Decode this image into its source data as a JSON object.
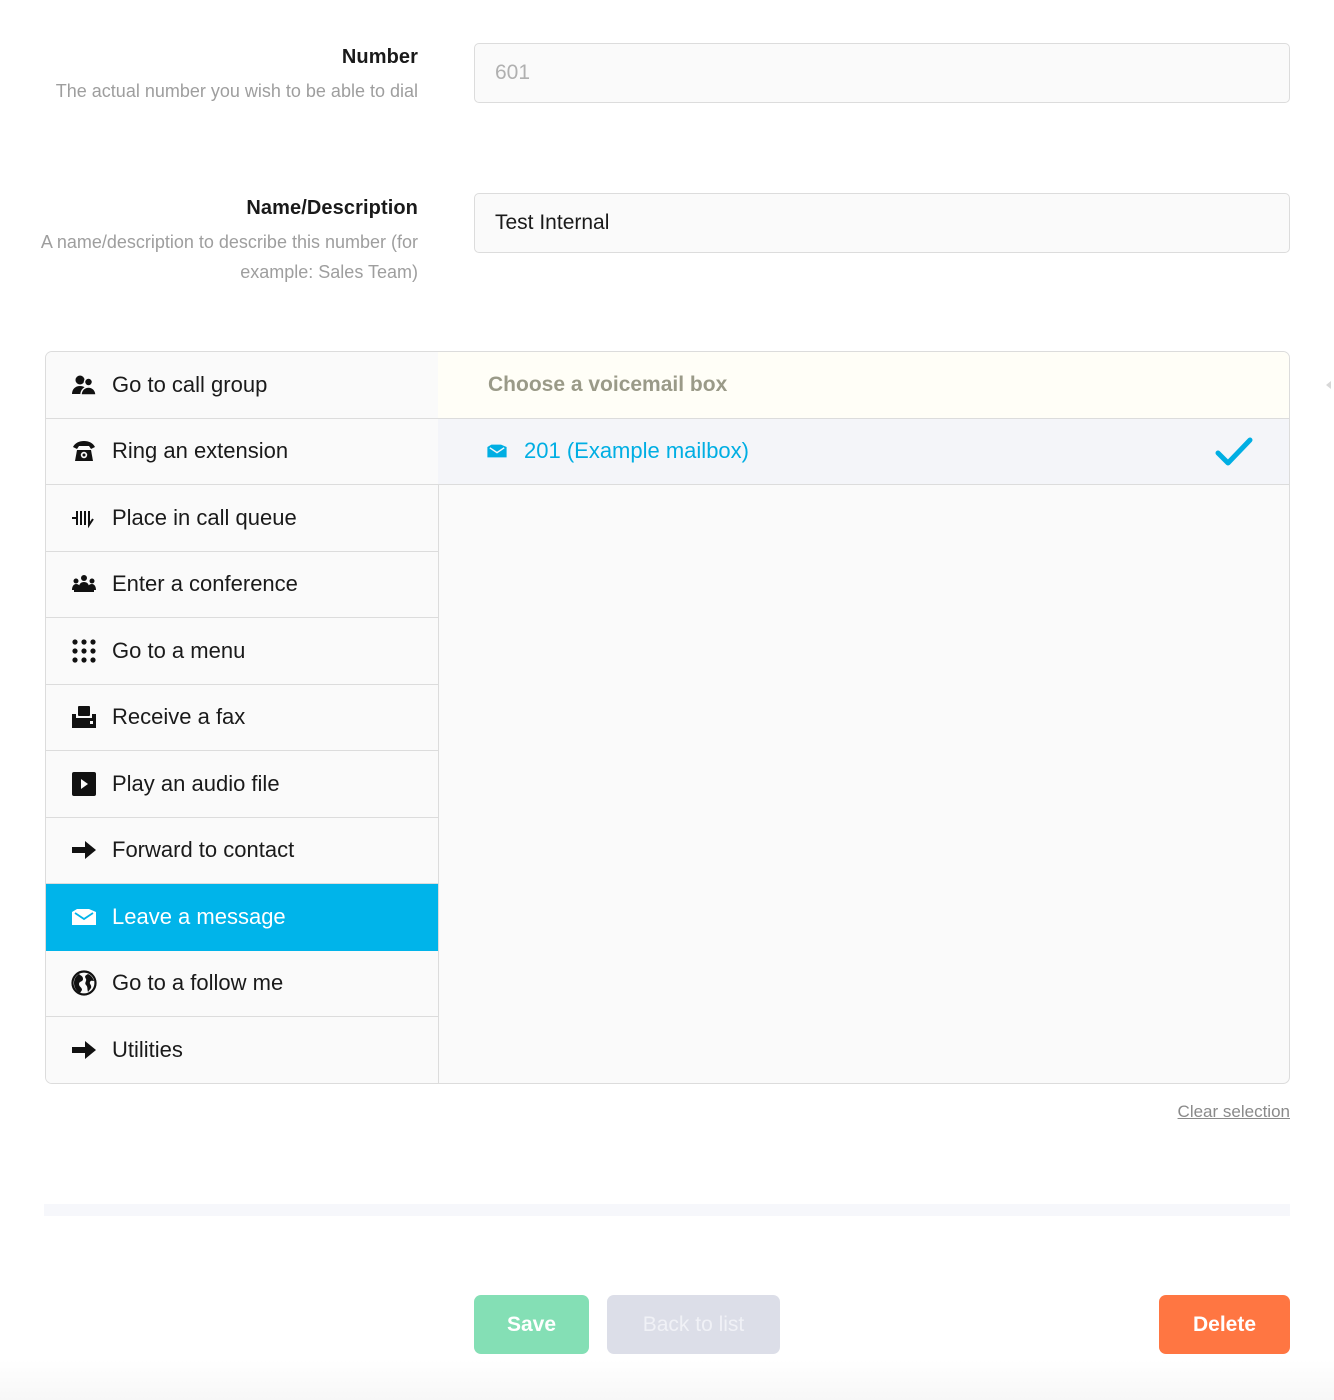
{
  "form": {
    "number": {
      "title": "Number",
      "help": "The actual number you wish to be able to dial",
      "value": "601"
    },
    "description": {
      "title": "Name/Description",
      "help": "A name/description to describe this number (for example: Sales Team)",
      "value": "Test Internal"
    }
  },
  "actions": [
    {
      "label": "Go to call group",
      "icon": "users-icon"
    },
    {
      "label": "Ring an extension",
      "icon": "phone-icon"
    },
    {
      "label": "Place in call queue",
      "icon": "queue-icon"
    },
    {
      "label": "Enter a conference",
      "icon": "conference-icon"
    },
    {
      "label": "Go to a menu",
      "icon": "keypad-icon"
    },
    {
      "label": "Receive a fax",
      "icon": "fax-icon"
    },
    {
      "label": "Play an audio file",
      "icon": "play-icon"
    },
    {
      "label": "Forward to contact",
      "icon": "arrow-right-icon"
    },
    {
      "label": "Leave a message",
      "icon": "envelope-icon",
      "active": true
    },
    {
      "label": "Go to a follow me",
      "icon": "globe-icon"
    },
    {
      "label": "Utilities",
      "icon": "arrow-right-icon"
    }
  ],
  "detail": {
    "header": "Choose a voicemail box",
    "options": [
      {
        "label": "201 (Example mailbox)",
        "selected": true,
        "icon": "envelope-icon"
      }
    ]
  },
  "clear_selection": "Clear selection",
  "buttons": {
    "save": "Save",
    "back": "Back to list",
    "delete": "Delete"
  },
  "colors": {
    "accent": "#00b4ea",
    "save": "#84dfb5",
    "back": "#dcdee8",
    "delete": "#ff7642"
  }
}
